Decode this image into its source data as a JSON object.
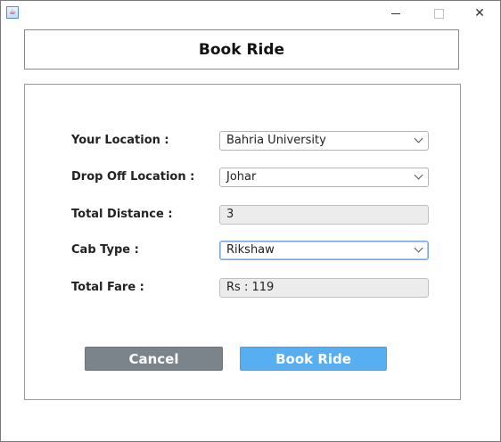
{
  "window": {
    "title": ""
  },
  "header": {
    "title": "Book Ride"
  },
  "form": {
    "your_location": {
      "label": "Your Location :",
      "value": "Bahria University"
    },
    "drop_off": {
      "label": "Drop Off Location :",
      "value": "Johar"
    },
    "distance": {
      "label": "Total Distance :",
      "value": "3"
    },
    "cab_type": {
      "label": "Cab Type :",
      "value": "Rikshaw"
    },
    "fare": {
      "label": "Total Fare :",
      "value": "Rs : 119"
    }
  },
  "buttons": {
    "cancel": "Cancel",
    "book": "Book Ride"
  },
  "colors": {
    "cancel_bg": "#7b848b",
    "book_bg": "#57aef0",
    "focus_border": "#7ba7dc"
  }
}
